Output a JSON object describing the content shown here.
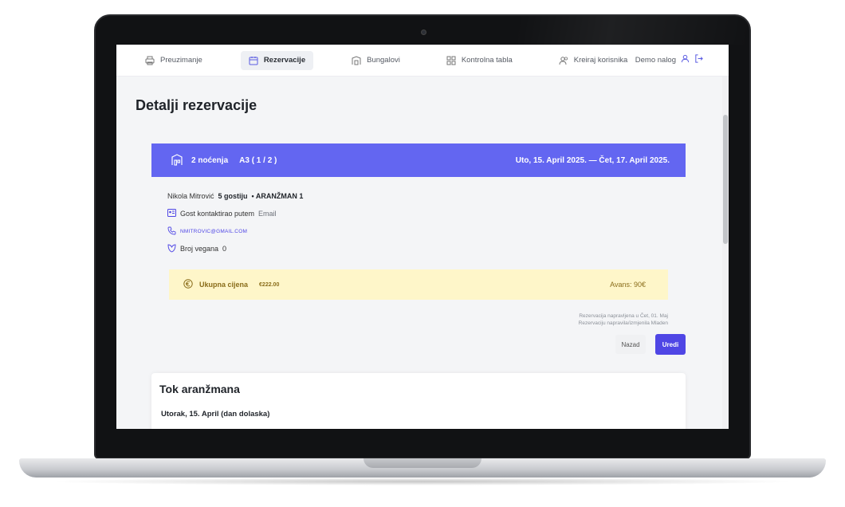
{
  "nav": {
    "items": [
      {
        "label": "Preuzimanje",
        "icon": "printer-icon"
      },
      {
        "label": "Rezervacije",
        "icon": "calendar-icon",
        "active": true
      },
      {
        "label": "Bungalovi",
        "icon": "bungalow-icon"
      },
      {
        "label": "Kontrolna tabla",
        "icon": "grid-icon"
      },
      {
        "label": "Kreiraj korisnika",
        "icon": "users-icon"
      }
    ],
    "user_label": "Demo nalog"
  },
  "page": {
    "title": "Detalji rezervacije"
  },
  "reservation": {
    "nights": "2 noćenja",
    "room": "A3 ( 1 / 2 )",
    "dates": "Uto, 15. April 2025. — Čet, 17. April 2025.",
    "guest_name": "Nikola Mitrović",
    "guests": "5 gostiju",
    "package": "• ARANŽMAN 1",
    "contact_label": "Gost kontaktirao putem",
    "contact_value": "Email",
    "email": "NMITROVIC@GMAIL.COM",
    "vegan_label": "Broj vegana",
    "vegan_value": "0",
    "total_label": "Ukupna cijena",
    "total_value": "€222.00",
    "deposit": "Avans: 90€",
    "meta_line1": "Rezervacija napravljena u Čet, 01. Maj",
    "meta_line2": "Rezervaciju napravila/izmjenila Mladen",
    "back_label": "Nazad",
    "edit_label": "Uredi"
  },
  "tok": {
    "title": "Tok aranžmana",
    "day1": "Utorak, 15. April (dan dolaska)"
  },
  "colors": {
    "accent": "#6366f1",
    "button": "#4f46e5",
    "price_bg": "#fef6c9"
  }
}
